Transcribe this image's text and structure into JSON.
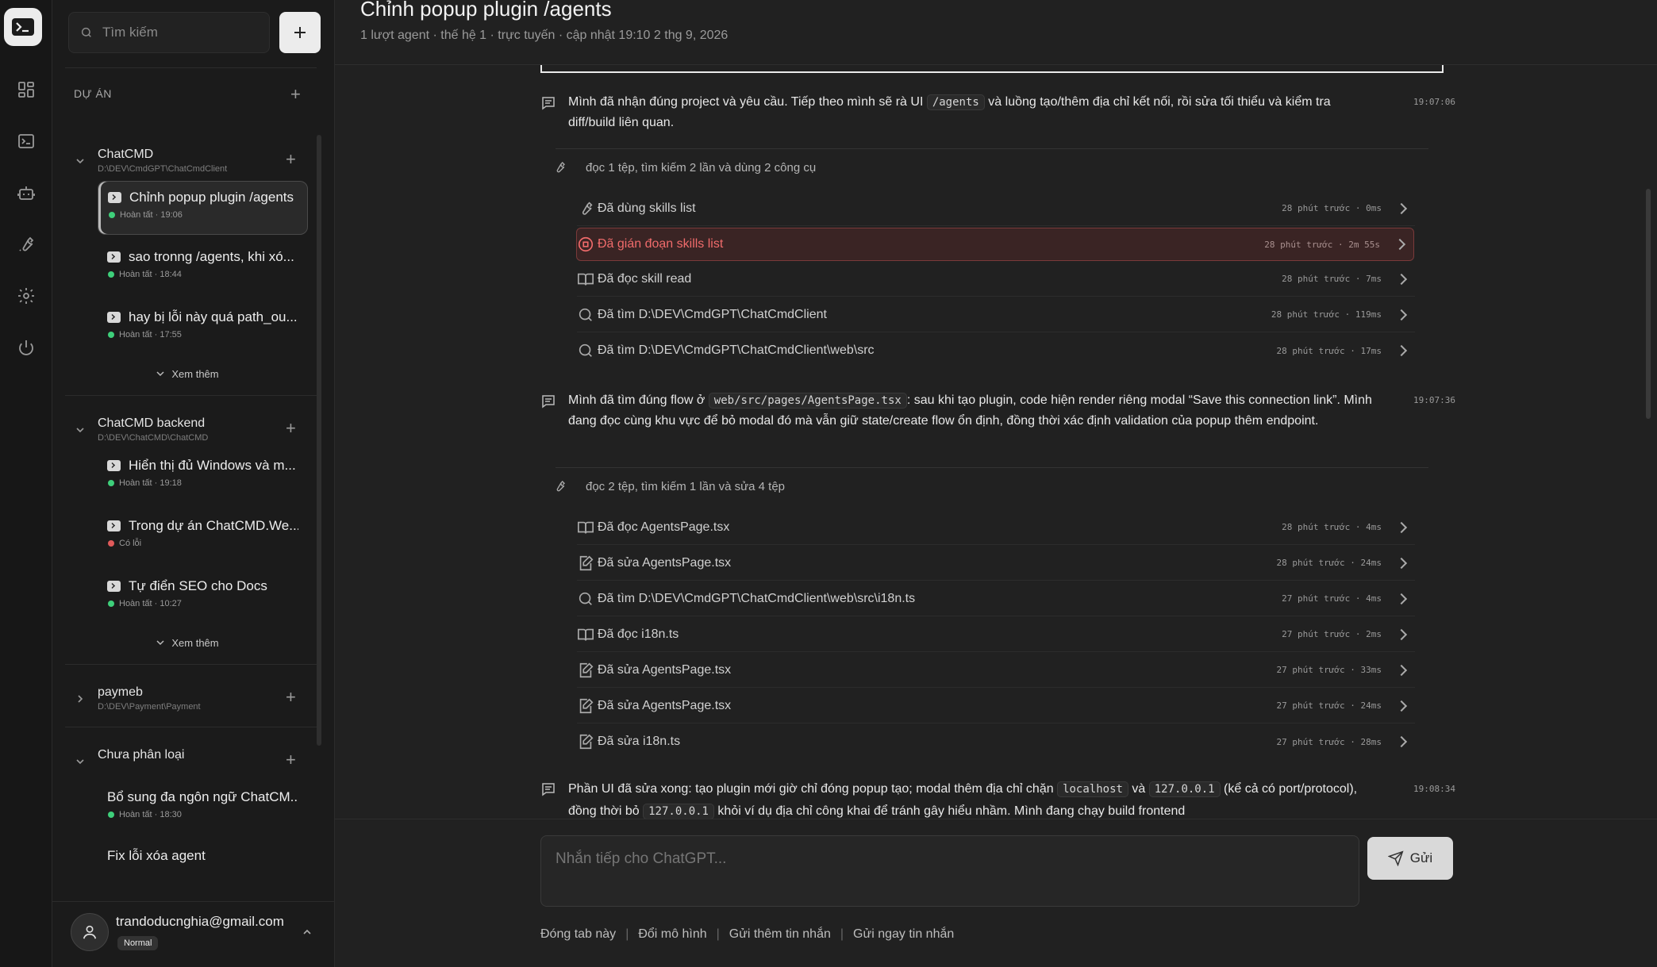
{
  "sidebar": {
    "search_placeholder": "Tìm kiếm",
    "section_label": "DỰ ÁN",
    "projects": [
      {
        "name": "ChatCMD",
        "path": "D:\\DEV\\CmdGPT\\ChatCmdClient",
        "expanded": true,
        "conversations": [
          {
            "title": "Chỉnh popup plugin /agents",
            "status": "Hoàn tất · 19:06",
            "state": "ok",
            "active": true
          },
          {
            "title": "sao tronng /agents, khi xó...",
            "status": "Hoàn tất · 18:44",
            "state": "ok"
          },
          {
            "title": "hay bị lỗi này quá path_ou...",
            "status": "Hoàn tất · 17:55",
            "state": "ok"
          }
        ],
        "more": "Xem thêm"
      },
      {
        "name": "ChatCMD backend",
        "path": "D:\\DEV\\ChatCMD\\ChatCMD",
        "expanded": true,
        "conversations": [
          {
            "title": "Hiển thị đủ Windows và m...",
            "status": "Hoàn tất · 19:18",
            "state": "ok"
          },
          {
            "title": "Trong dự án ChatCMD.We...",
            "status": "Có lỗi",
            "state": "error"
          },
          {
            "title": "Tự điển SEO cho Docs",
            "status": "Hoàn tất · 10:27",
            "state": "ok"
          }
        ],
        "more": "Xem thêm"
      },
      {
        "name": "paymeb",
        "path": "D:\\DEV\\Payment\\Payment",
        "expanded": false,
        "conversations": []
      },
      {
        "name": "Chưa phân loại",
        "path": "",
        "expanded": true,
        "conversations": [
          {
            "title": "Bổ sung đa ngôn ngữ ChatCM...",
            "status": "Hoàn tất · 18:30",
            "state": "ok",
            "no_icon": true
          },
          {
            "title": "Fix lỗi xóa agent",
            "status": "",
            "state": "ok",
            "no_icon": true
          }
        ]
      }
    ],
    "user": {
      "email": "trandoducnghia@gmail.com",
      "plan": "Normal"
    }
  },
  "header": {
    "title": "Chỉnh popup plugin /agents",
    "subtitle": "1 lượt agent · thế hệ 1 · trực tuyến · cập nhật 19:10 2 thg 9, 2026"
  },
  "chat": {
    "msg1": {
      "before": "Mình đã nhận đúng project và yêu cầu. Tiếp theo mình sẽ rà UI ",
      "code": "/agents",
      "after": " và luồng tạo/thêm địa chỉ kết nối, rồi sửa tối thiểu và kiểm tra diff/build liên quan.",
      "time": "19:07:06"
    },
    "group1": {
      "summary": "đọc 1 tệp, tìm kiếm 2 lần và dùng 2 công cụ",
      "tools": [
        {
          "icon": "wrench-icon",
          "label": "Đã dùng skills list",
          "meta": "28 phút trước · 0ms"
        },
        {
          "icon": "stop-icon",
          "label": "Đã gián đoạn skills list",
          "meta": "28 phút trước · 2m 55s",
          "error": true
        },
        {
          "icon": "book-icon",
          "label": "Đã đọc skill read",
          "meta": "28 phút trước · 7ms"
        },
        {
          "icon": "search-icon",
          "label": "Đã tìm D:\\DEV\\CmdGPT\\ChatCmdClient",
          "meta": "28 phút trước · 119ms"
        },
        {
          "icon": "search-icon",
          "label": "Đã tìm D:\\DEV\\CmdGPT\\ChatCmdClient\\web\\src",
          "meta": "28 phút trước · 17ms"
        }
      ]
    },
    "msg2": {
      "before": "Mình đã tìm đúng flow ở ",
      "code": "web/src/pages/AgentsPage.tsx",
      "after": ": sau khi tạo plugin, code hiện render riêng modal “Save this connection link”. Mình đang đọc cùng khu vực để bỏ modal đó mà vẫn giữ state/create flow ổn định, đồng thời xác định validation của popup thêm endpoint.",
      "time": "19:07:36"
    },
    "group2": {
      "summary": "đọc 2 tệp, tìm kiếm 1 lần và sửa 4 tệp",
      "tools": [
        {
          "icon": "book-icon",
          "label": "Đã đọc AgentsPage.tsx",
          "meta": "28 phút trước · 4ms"
        },
        {
          "icon": "edit-icon",
          "label": "Đã sửa AgentsPage.tsx",
          "meta": "28 phút trước · 24ms"
        },
        {
          "icon": "search-icon",
          "label": "Đã tìm D:\\DEV\\CmdGPT\\ChatCmdClient\\web\\src\\i18n.ts",
          "meta": "27 phút trước · 4ms"
        },
        {
          "icon": "book-icon",
          "label": "Đã đọc i18n.ts",
          "meta": "27 phút trước · 2ms"
        },
        {
          "icon": "edit-icon",
          "label": "Đã sửa AgentsPage.tsx",
          "meta": "27 phút trước · 33ms"
        },
        {
          "icon": "edit-icon",
          "label": "Đã sửa AgentsPage.tsx",
          "meta": "27 phút trước · 24ms"
        },
        {
          "icon": "edit-icon",
          "label": "Đã sửa i18n.ts",
          "meta": "27 phút trước · 28ms"
        }
      ]
    },
    "msg3": {
      "p1": "Phần UI đã sửa xong: tạo plugin mới giờ chỉ đóng popup tạo; modal thêm địa chỉ chặn ",
      "c1": "localhost",
      "p2": " và ",
      "c2": "127.0.0.1",
      "p3": " (kể cả có port/protocol), đồng thời bỏ ",
      "c3": "127.0.0.1",
      "p4": " khỏi ví dụ địa chỉ công khai để tránh gây hiểu nhầm. Mình đang chạy build frontend",
      "time": "19:08:34"
    }
  },
  "composer": {
    "placeholder": "Nhắn tiếp cho ChatGPT...",
    "send_label": "Gửi",
    "actions": [
      "Đóng tab này",
      "Đổi mô hình",
      "Gửi thêm tin nhắn",
      "Gửi ngay tin nhắn"
    ]
  }
}
